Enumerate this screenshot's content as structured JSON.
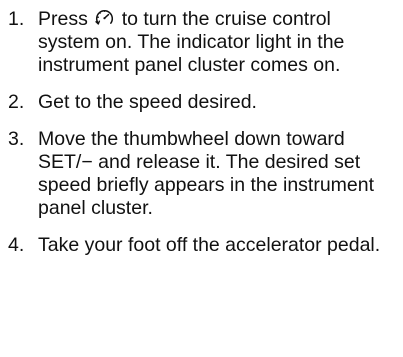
{
  "steps": [
    {
      "number": "1.",
      "text_before_icon": "Press ",
      "icon": "cruise-control-icon",
      "text_after_icon": " to turn the cruise control system on. The indicator light in the instrument panel cluster comes on."
    },
    {
      "number": "2.",
      "text": "Get to the speed desired."
    },
    {
      "number": "3.",
      "text": "Move the thumbwheel down toward SET/− and release it. The desired set speed briefly appears in the instrument panel cluster."
    },
    {
      "number": "4.",
      "text": "Take your foot off the accelerator pedal."
    }
  ]
}
